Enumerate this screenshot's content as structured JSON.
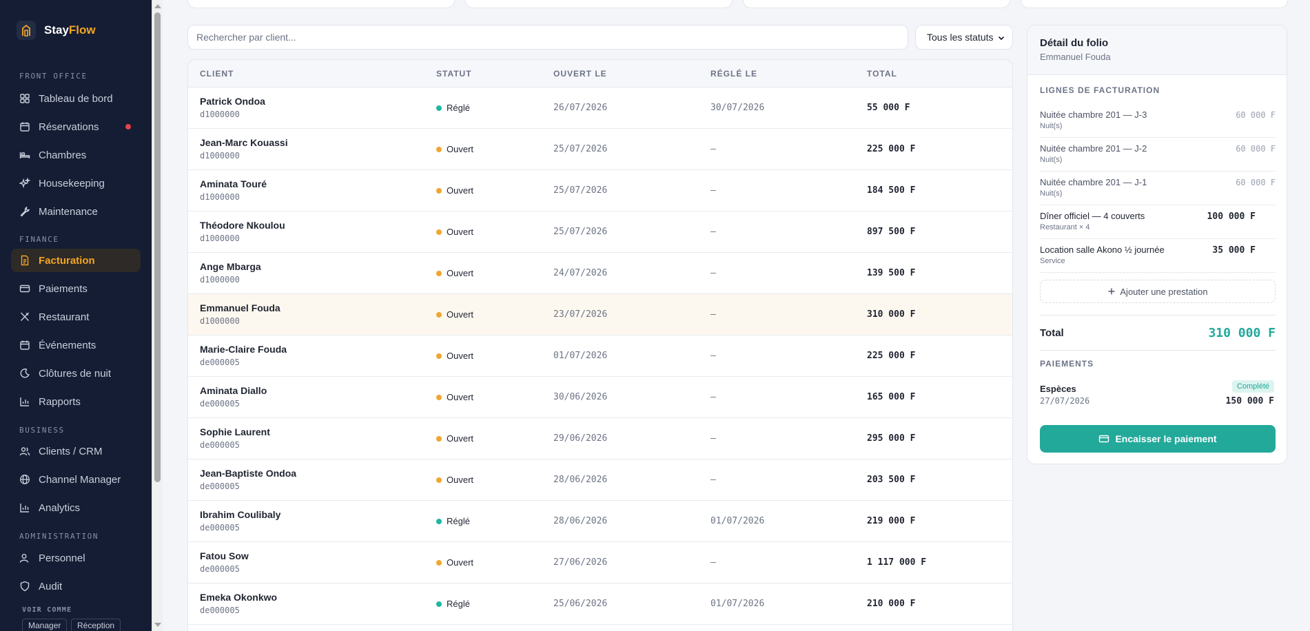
{
  "brand": {
    "name_part1": "Stay",
    "name_part2": "Flow"
  },
  "sidebar": {
    "sections": [
      {
        "label": "FRONT OFFICE"
      },
      {
        "label": "FINANCE"
      },
      {
        "label": "BUSINESS"
      },
      {
        "label": "ADMINISTRATION"
      }
    ],
    "items": [
      {
        "label": "Tableau de bord",
        "icon": "grid-icon"
      },
      {
        "label": "Réservations",
        "icon": "calendar-icon",
        "notification": true
      },
      {
        "label": "Chambres",
        "icon": "bed-icon"
      },
      {
        "label": "Housekeeping",
        "icon": "sparkles-icon"
      },
      {
        "label": "Maintenance",
        "icon": "wrench-icon"
      },
      {
        "label": "Facturation",
        "icon": "receipt-icon",
        "active": true
      },
      {
        "label": "Paiements",
        "icon": "credit-card-icon"
      },
      {
        "label": "Restaurant",
        "icon": "utensils-icon"
      },
      {
        "label": "Événements",
        "icon": "calendar-icon"
      },
      {
        "label": "Clôtures de nuit",
        "icon": "moon-icon"
      },
      {
        "label": "Rapports",
        "icon": "bar-chart-icon"
      },
      {
        "label": "Clients / CRM",
        "icon": "users-icon"
      },
      {
        "label": "Channel Manager",
        "icon": "globe-icon"
      },
      {
        "label": "Analytics",
        "icon": "bar-chart-icon"
      },
      {
        "label": "Personnel",
        "icon": "user-icon"
      },
      {
        "label": "Audit",
        "icon": "shield-icon"
      }
    ],
    "view_as": {
      "label": "VOIR COMME",
      "roles": [
        "Manager",
        "Réception"
      ]
    }
  },
  "search": {
    "placeholder": "Rechercher par client...",
    "value": ""
  },
  "status_filter": {
    "selected": "Tous les statuts"
  },
  "table": {
    "columns": [
      "CLIENT",
      "STATUT",
      "OUVERT LE",
      "RÉGLÉ LE",
      "TOTAL"
    ],
    "rows": [
      {
        "client": "Patrick Ondoa",
        "ref": "d1000000",
        "status": "Réglé",
        "opened": "26/07/2026",
        "settled": "30/07/2026",
        "total": "55 000 F"
      },
      {
        "client": "Jean-Marc Kouassi",
        "ref": "d1000000",
        "status": "Ouvert",
        "opened": "25/07/2026",
        "settled": "—",
        "total": "225 000 F"
      },
      {
        "client": "Aminata Touré",
        "ref": "d1000000",
        "status": "Ouvert",
        "opened": "25/07/2026",
        "settled": "—",
        "total": "184 500 F"
      },
      {
        "client": "Théodore Nkoulou",
        "ref": "d1000000",
        "status": "Ouvert",
        "opened": "25/07/2026",
        "settled": "—",
        "total": "897 500 F"
      },
      {
        "client": "Ange Mbarga",
        "ref": "d1000000",
        "status": "Ouvert",
        "opened": "24/07/2026",
        "settled": "—",
        "total": "139 500 F"
      },
      {
        "client": "Emmanuel Fouda",
        "ref": "d1000000",
        "status": "Ouvert",
        "opened": "23/07/2026",
        "settled": "—",
        "total": "310 000 F",
        "selected": true
      },
      {
        "client": "Marie-Claire Fouda",
        "ref": "de000005",
        "status": "Ouvert",
        "opened": "01/07/2026",
        "settled": "—",
        "total": "225 000 F"
      },
      {
        "client": "Aminata Diallo",
        "ref": "de000005",
        "status": "Ouvert",
        "opened": "30/06/2026",
        "settled": "—",
        "total": "165 000 F"
      },
      {
        "client": "Sophie Laurent",
        "ref": "de000005",
        "status": "Ouvert",
        "opened": "29/06/2026",
        "settled": "—",
        "total": "295 000 F"
      },
      {
        "client": "Jean-Baptiste Ondoa",
        "ref": "de000005",
        "status": "Ouvert",
        "opened": "28/06/2026",
        "settled": "—",
        "total": "203 500 F"
      },
      {
        "client": "Ibrahim Coulibaly",
        "ref": "de000005",
        "status": "Réglé",
        "opened": "28/06/2026",
        "settled": "01/07/2026",
        "total": "219 000 F"
      },
      {
        "client": "Fatou Sow",
        "ref": "de000005",
        "status": "Ouvert",
        "opened": "27/06/2026",
        "settled": "—",
        "total": "1 117 000 F"
      },
      {
        "client": "Emeka Okonkwo",
        "ref": "de000005",
        "status": "Réglé",
        "opened": "25/06/2026",
        "settled": "01/07/2026",
        "total": "210 000 F"
      }
    ]
  },
  "colors": {
    "status_settled": "#1fb5a3",
    "status_open": "#f0a630",
    "accent": "#f5a524",
    "teal": "#22a99a"
  },
  "detail": {
    "title": "Détail du folio",
    "client": "Emmanuel Fouda",
    "lines_label": "LIGNES DE FACTURATION",
    "lines": [
      {
        "label": "Nuitée chambre 201 — J-3",
        "sub": "Nuit(s)",
        "amount": "60 000 F",
        "muted": true
      },
      {
        "label": "Nuitée chambre 201 — J-2",
        "sub": "Nuit(s)",
        "amount": "60 000 F",
        "muted": true
      },
      {
        "label": "Nuitée chambre 201 — J-1",
        "sub": "Nuit(s)",
        "amount": "60 000 F",
        "muted": true
      },
      {
        "label": "Dîner officiel — 4 couverts",
        "sub": "Restaurant × 4",
        "amount": "100 000 F",
        "muted": false
      },
      {
        "label": "Location salle Akono ½ journée",
        "sub": "Service",
        "amount": "35 000 F",
        "muted": false
      }
    ],
    "add_label": "Ajouter une prestation",
    "total_label": "Total",
    "total_amount": "310 000 F",
    "payments_label": "PAIEMENTS",
    "payment": {
      "method": "Espèces",
      "date": "27/07/2026",
      "badge": "Complété",
      "amount": "150 000 F"
    },
    "cash_button": "Encaisser le paiement"
  }
}
